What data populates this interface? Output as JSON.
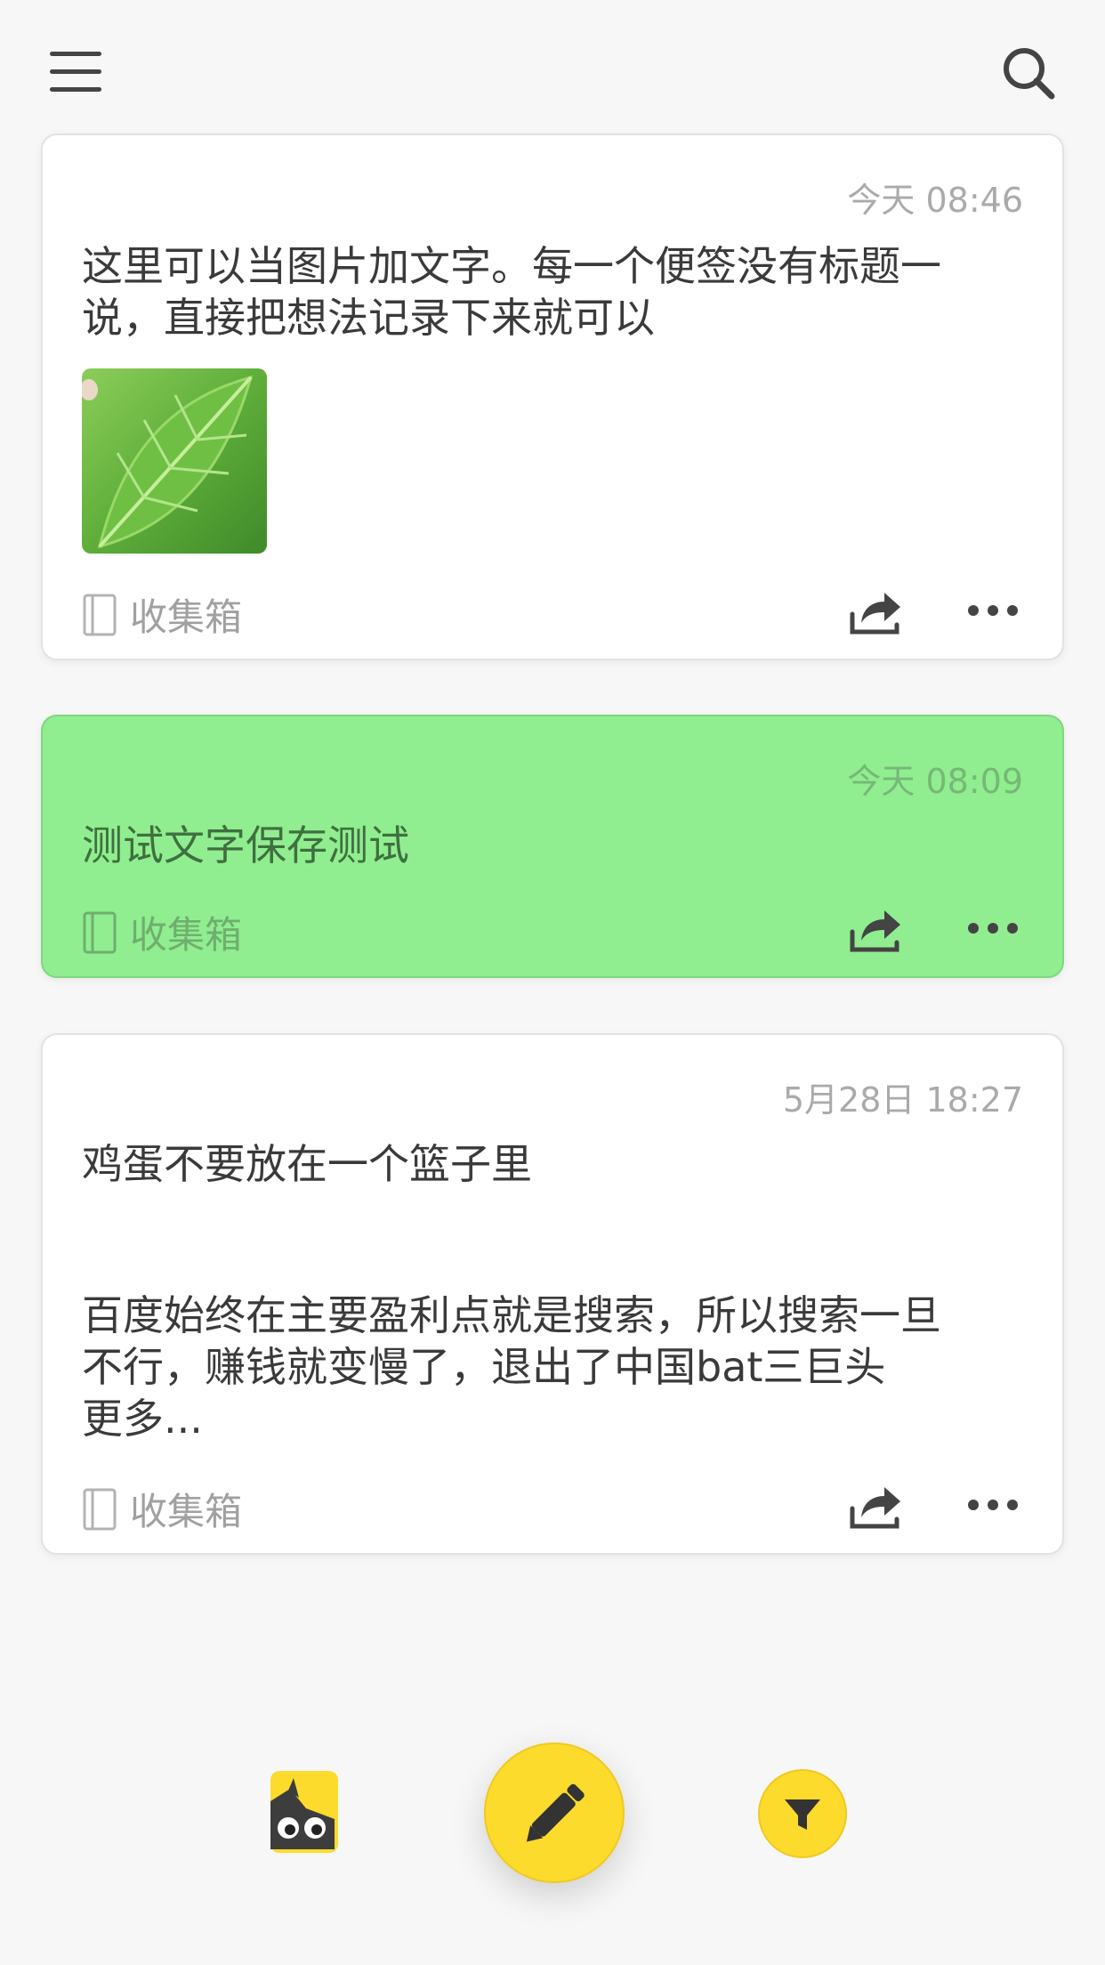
{
  "topbar": {
    "menu_icon": "hamburger-icon",
    "search_icon": "search-icon"
  },
  "notes": [
    {
      "time": "今天 08:46",
      "text_lines": [
        "这里可以当图片加文字。每一个便签没有标题一",
        "说，直接把想法记录下来就可以"
      ],
      "has_image": true,
      "image_icon": "leaf-photo",
      "notebook": "收集箱",
      "bg_color": "#ffffff"
    },
    {
      "time": "今天 08:09",
      "text_lines": [
        "测试文字保存测试"
      ],
      "notebook": "收集箱",
      "bg_color": "#90ee90"
    },
    {
      "time": "5月28日 18:27",
      "title": "鸡蛋不要放在一个篮子里",
      "text_lines": [
        "百度始终在主要盈利点就是搜索，所以搜索一旦",
        "不行，赚钱就变慢了，退出了中国bat三巨头",
        "更多..."
      ],
      "notebook": "收集箱",
      "bg_color": "#ffffff"
    }
  ],
  "bottombar": {
    "mascot_icon": "mascot-icon",
    "new_note_icon": "pencil-icon",
    "filter_icon": "filter-icon",
    "accent_color": "#fcdb2c"
  }
}
